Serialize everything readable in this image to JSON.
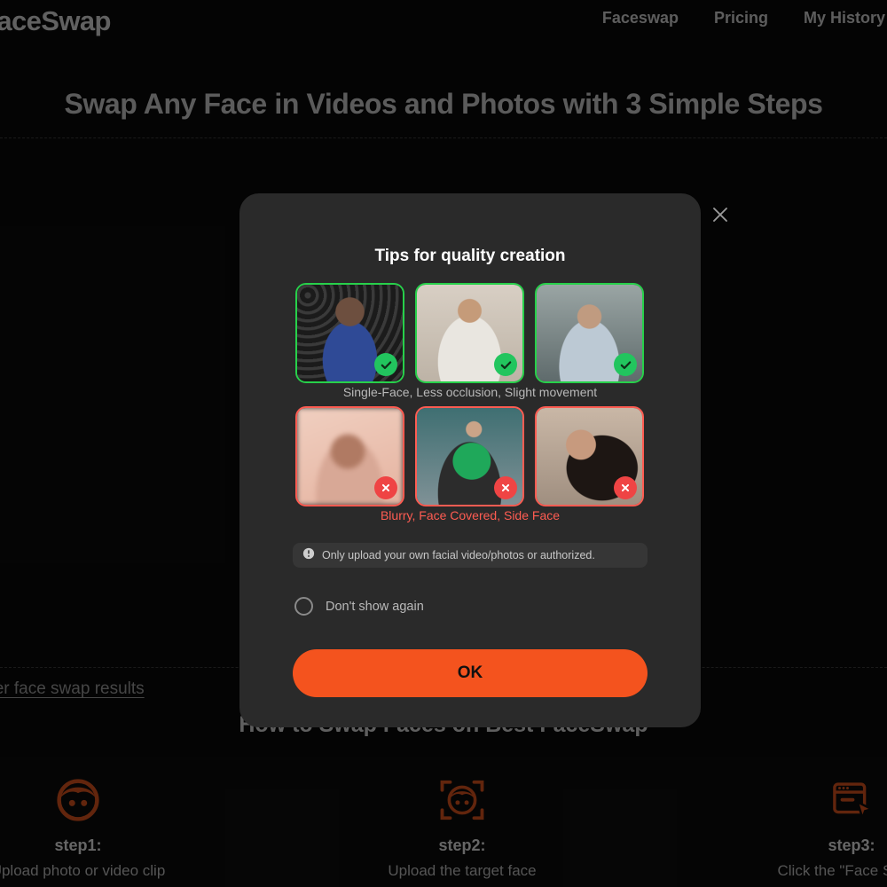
{
  "header": {
    "logo": "FaceSwap",
    "nav": [
      {
        "label": "Faceswap"
      },
      {
        "label": "Pricing"
      },
      {
        "label": "My History"
      }
    ]
  },
  "page": {
    "hero_title": "Swap Any Face in Videos and Photos with 3 Simple Steps",
    "results_link": "better face swap results",
    "sub_heading": "How to Swap Faces on Best FaceSwap"
  },
  "steps": {
    "items": [
      {
        "name": "step1:",
        "desc": "Upload photo or video clip",
        "icon": "face-icon"
      },
      {
        "name": "step2:",
        "desc": "Upload the target face",
        "icon": "face-scan-icon"
      },
      {
        "name": "step3:",
        "desc": "Click the \"Face Swap\"",
        "icon": "browser-cursor-icon"
      }
    ]
  },
  "modal": {
    "title": "Tips for quality creation",
    "close_icon": "close-icon",
    "good_examples": [
      {
        "badge": "check-icon"
      },
      {
        "badge": "check-icon"
      },
      {
        "badge": "check-icon"
      }
    ],
    "good_caption": "Single-Face, Less occlusion, Slight movement",
    "bad_examples": [
      {
        "badge": "cross-icon"
      },
      {
        "badge": "cross-icon"
      },
      {
        "badge": "cross-icon"
      }
    ],
    "bad_caption": "Blurry, Face Covered, Side Face",
    "notice": {
      "icon": "info-icon",
      "text": "Only upload your own facial video/photos or authorized."
    },
    "dont_show": {
      "label": "Don't show again",
      "checked": false
    },
    "confirm_label": "OK"
  },
  "colors": {
    "accent_orange": "#f4531e",
    "good_green": "#22c55e",
    "bad_red": "#ef4444",
    "page_bg": "#0b0b0b",
    "modal_bg": "#2a2a2a"
  }
}
